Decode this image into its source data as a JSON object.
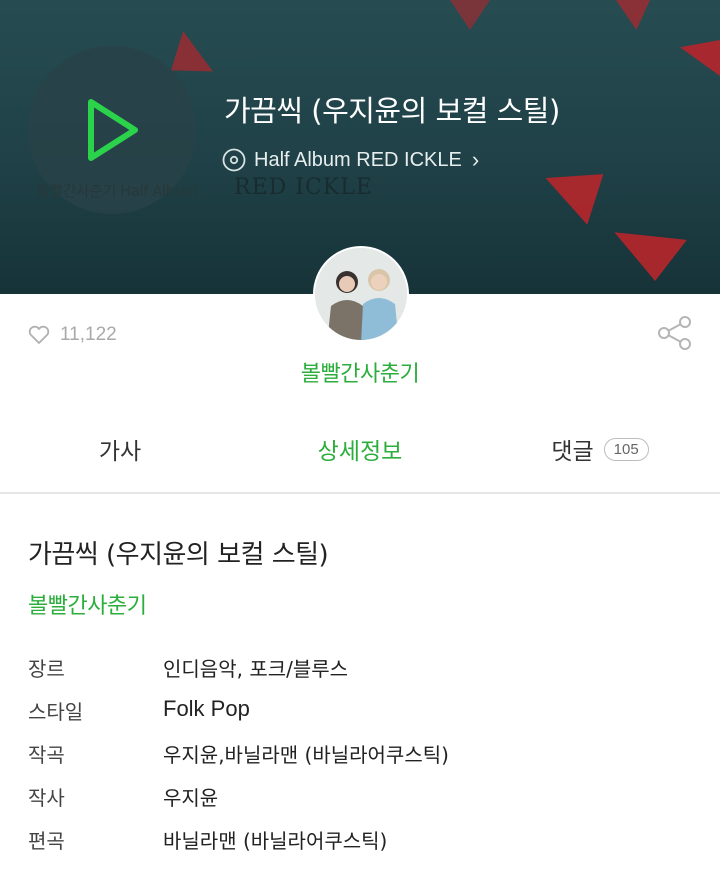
{
  "header": {
    "song_title": "가끔씩 (우지윤의 보컬 스틸)",
    "album_name": "Half Album RED ICKLE",
    "cover_caption": "볼빨간사춘기 Half Album",
    "cover_wordmark": "RED ICKLE"
  },
  "artist": {
    "name": "볼빨간사춘기",
    "like_count": "11,122"
  },
  "tabs": [
    {
      "label": "가사",
      "active": false
    },
    {
      "label": "상세정보",
      "active": true
    },
    {
      "label": "댓글",
      "count": "105",
      "active": false
    }
  ],
  "detail": {
    "title": "가끔씩 (우지윤의 보컬 스틸)",
    "artist": "볼빨간사춘기",
    "rows": [
      {
        "key": "장르",
        "value": "인디음악, 포크/블루스"
      },
      {
        "key": "스타일",
        "value": "Folk Pop"
      },
      {
        "key": "작곡",
        "value": "우지윤,바닐라맨 (바닐라어쿠스틱)"
      },
      {
        "key": "작사",
        "value": "우지윤"
      },
      {
        "key": "편곡",
        "value": "바닐라맨 (바닐라어쿠스틱)"
      }
    ]
  },
  "icons": [
    "play-icon",
    "disc-icon",
    "chevron-right-icon",
    "heart-icon",
    "share-icon"
  ],
  "colors": {
    "accent": "#2cae3c",
    "banner": "#1f4147",
    "petal": "#b3262b"
  }
}
